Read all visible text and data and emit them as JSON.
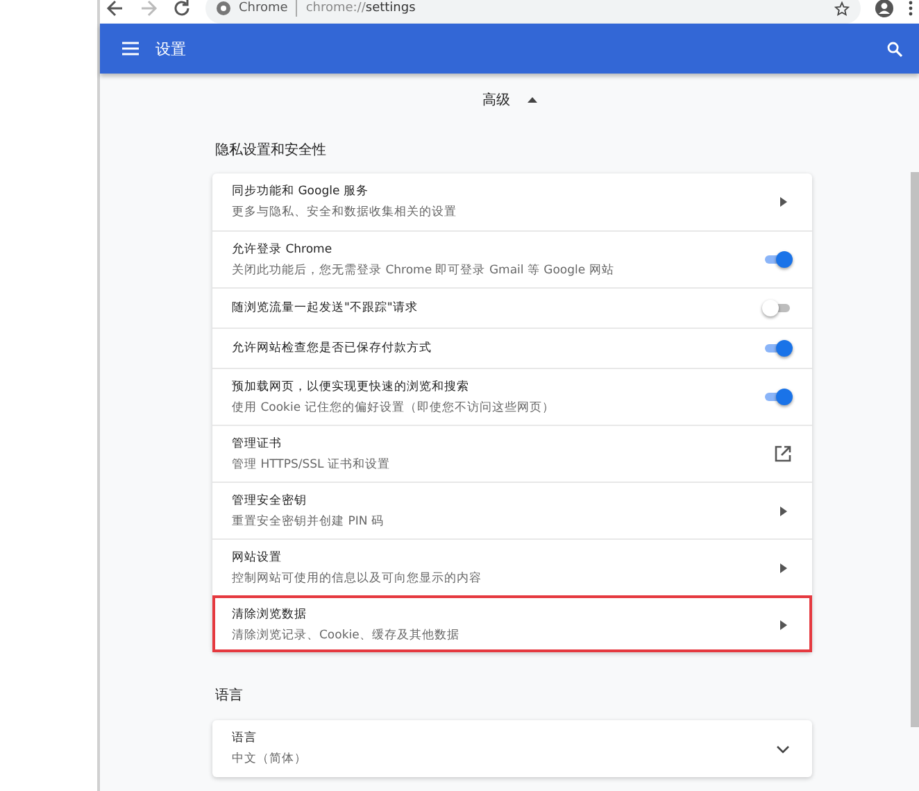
{
  "toolbar": {
    "site_label": "Chrome",
    "url_prefix": "chrome://",
    "url_path": "settings",
    "forward_disabled": true
  },
  "header": {
    "title": "设置"
  },
  "advanced": {
    "label": "高级",
    "expanded": true
  },
  "sections": [
    {
      "title": "隐私设置和安全性",
      "items": [
        {
          "kind": "arrow",
          "title": "同步功能和 Google 服务",
          "subtitle": "更多与隐私、安全和数据收集相关的设置",
          "highlighted": false
        },
        {
          "kind": "toggle",
          "title": "允许登录 Chrome",
          "subtitle": "关闭此功能后，您无需登录 Chrome 即可登录 Gmail 等 Google 网站",
          "on": true,
          "highlighted": false
        },
        {
          "kind": "toggle",
          "title": "随浏览流量一起发送\"不跟踪\"请求",
          "on": false,
          "highlighted": false
        },
        {
          "kind": "toggle",
          "title": "允许网站检查您是否已保存付款方式",
          "on": true,
          "highlighted": false
        },
        {
          "kind": "toggle",
          "title": "预加载网页，以便实现更快速的浏览和搜索",
          "subtitle": "使用 Cookie 记住您的偏好设置（即使您不访问这些网页）",
          "on": true,
          "highlighted": false
        },
        {
          "kind": "external",
          "title": "管理证书",
          "subtitle": "管理 HTTPS/SSL 证书和设置",
          "highlighted": false
        },
        {
          "kind": "arrow",
          "title": "管理安全密钥",
          "subtitle": "重置安全密钥并创建 PIN 码",
          "highlighted": false
        },
        {
          "kind": "arrow",
          "title": "网站设置",
          "subtitle": "控制网站可使用的信息以及可向您显示的内容",
          "highlighted": false
        },
        {
          "kind": "arrow",
          "title": "清除浏览数据",
          "subtitle": "清除浏览记录、Cookie、缓存及其他数据",
          "highlighted": true
        }
      ]
    },
    {
      "title": "语言",
      "items": [
        {
          "kind": "dropdown",
          "title": "语言",
          "subtitle": "中文（简体）",
          "highlighted": false
        }
      ]
    }
  ]
}
